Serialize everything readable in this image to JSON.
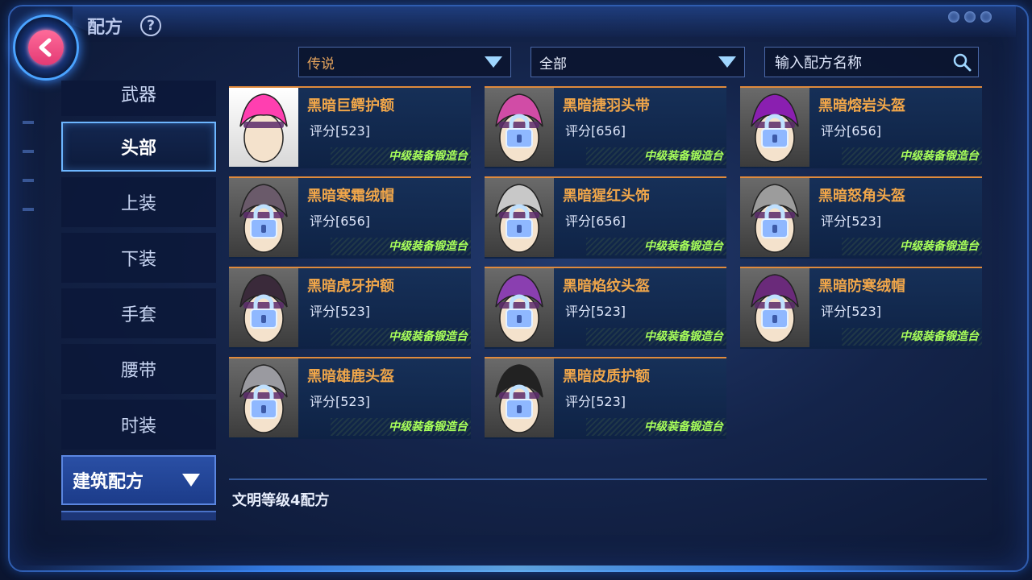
{
  "header": {
    "title": "配方",
    "help_icon": "?"
  },
  "filters": {
    "rarity": "传说",
    "category": "全部",
    "search_placeholder": "输入配方名称"
  },
  "sidebar": {
    "items": [
      {
        "label": "武器"
      },
      {
        "label": "头部"
      },
      {
        "label": "上装"
      },
      {
        "label": "下装"
      },
      {
        "label": "手套"
      },
      {
        "label": "腰带"
      },
      {
        "label": "时装"
      }
    ],
    "active": "头部",
    "group_label": "建筑配方"
  },
  "recipes": [
    {
      "name": "黑暗巨鳄护额",
      "score": "评分[523]",
      "source": "中级装备锻造台",
      "locked": false,
      "hair": "#ff3fb0"
    },
    {
      "name": "黑暗捷羽头带",
      "score": "评分[656]",
      "source": "中级装备锻造台",
      "locked": true,
      "hair": "#d14ca6"
    },
    {
      "name": "黑暗熔岩头盔",
      "score": "评分[656]",
      "source": "中级装备锻造台",
      "locked": true,
      "hair": "#8a1fb0"
    },
    {
      "name": "黑暗寒霜绒帽",
      "score": "评分[656]",
      "source": "中级装备锻造台",
      "locked": true,
      "hair": "#6a5a6a"
    },
    {
      "name": "黑暗猩红头饰",
      "score": "评分[656]",
      "source": "中级装备锻造台",
      "locked": true,
      "hair": "#c8c8c8"
    },
    {
      "name": "黑暗怒角头盔",
      "score": "评分[523]",
      "source": "中级装备锻造台",
      "locked": true,
      "hair": "#9c9c9c"
    },
    {
      "name": "黑暗虎牙护额",
      "score": "评分[523]",
      "source": "中级装备锻造台",
      "locked": true,
      "hair": "#3a2a3a"
    },
    {
      "name": "黑暗焰纹头盔",
      "score": "评分[523]",
      "source": "中级装备锻造台",
      "locked": true,
      "hair": "#8a3fb0"
    },
    {
      "name": "黑暗防寒绒帽",
      "score": "评分[523]",
      "source": "中级装备锻造台",
      "locked": true,
      "hair": "#6a2a7a"
    },
    {
      "name": "黑暗雄鹿头盔",
      "score": "评分[523]",
      "source": "中级装备锻造台",
      "locked": true,
      "hair": "#9a9aa0"
    },
    {
      "name": "黑暗皮质护额",
      "score": "评分[523]",
      "source": "中级装备锻造台",
      "locked": true,
      "hair": "#222222"
    }
  ],
  "footer": {
    "civ_label": "文明等级4配方"
  },
  "colors": {
    "accent": "#f0a64a",
    "source_text": "#a8ff5a",
    "lock": "#bfe0ff"
  }
}
